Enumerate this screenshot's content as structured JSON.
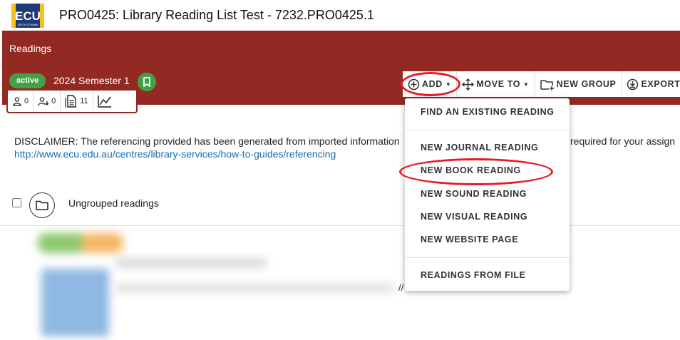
{
  "header": {
    "logo_text": "ECU",
    "logo_subtext": "EDITH COWAN",
    "title": "PRO0425: Library Reading List Test - 7232.PRO0425.1"
  },
  "banner": {
    "section_label": "Readings",
    "status": "active",
    "semester": "2024 Semester 1",
    "color": "#922a23",
    "stats": [
      {
        "icon": "person-icon",
        "value": "0"
      },
      {
        "icon": "person-download-icon",
        "value": "0"
      },
      {
        "icon": "document-icon",
        "value": "11"
      },
      {
        "icon": "chart-icon",
        "value": ""
      }
    ]
  },
  "toolbar": {
    "add": "ADD",
    "move_to": "MOVE TO",
    "new_group": "NEW GROUP",
    "export": "EXPORT"
  },
  "add_menu": {
    "items": [
      "FIND AN EXISTING READING",
      "NEW JOURNAL READING",
      "NEW BOOK READING",
      "NEW SOUND READING",
      "NEW VISUAL READING",
      "NEW WEBSITE PAGE",
      "READINGS FROM FILE"
    ]
  },
  "content": {
    "disclaimer": "DISCLAIMER: The referencing provided has been generated from imported information",
    "disclaimer_tail": "required for your assign",
    "link": "http://www.ecu.edu.au/centres/library-services/how-to-guides/referencing",
    "group_label": "Ungrouped readings"
  },
  "colors": {
    "accent_red": "#e41e26",
    "badge_green": "#43a047",
    "link_blue": "#1a6aa8"
  }
}
